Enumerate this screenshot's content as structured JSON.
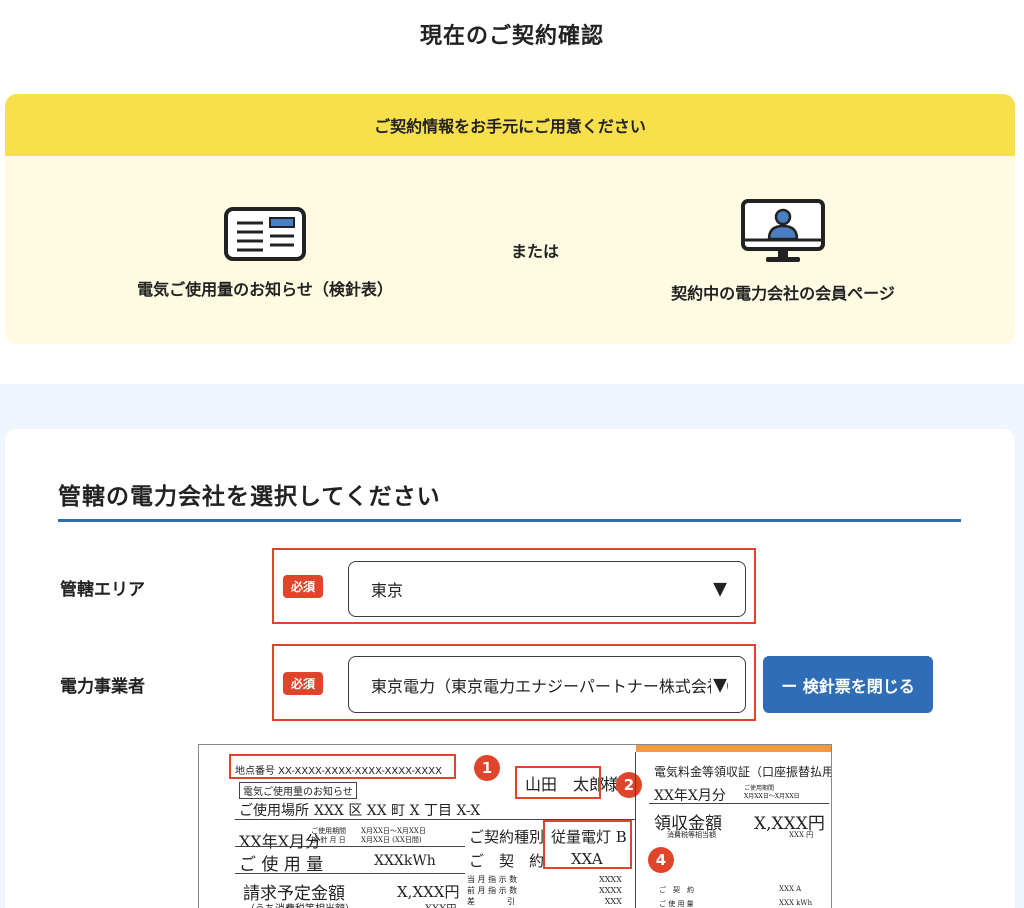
{
  "page_title": "現在のご契約確認",
  "prep": {
    "heading": "ご契約情報をお手元にご用意ください",
    "option_meter": "電気ご使用量のお知らせ（検針表）",
    "or_text": "または",
    "option_member": "契約中の電力会社の会員ページ"
  },
  "form": {
    "section_title": "管轄の電力会社を選択してください",
    "area": {
      "label": "管轄エリア",
      "required": "必須",
      "value": "東京"
    },
    "provider": {
      "label": "電力事業者",
      "required": "必須",
      "value": "東京電力（東京電力エナジーパートナー株式会社）"
    },
    "close_button": "ー 検針票を閉じる"
  },
  "slip": {
    "point_number": "地点番号 XX-XXXX-XXXX-XXXX-XXXX-XXXX",
    "notice_title": "電気ご使用量のお知らせ",
    "address_label": "ご使用場所",
    "address_value": "XXX 区 XX 町 X 丁目 X-X",
    "name": "山田　太郎",
    "name_suffix": "様",
    "month": "XX年X月分",
    "period_label": "ご使用期間\n検 針 月 日",
    "period_value": "X月XX日〜X月XX日\nX月XX日 (XX日間)",
    "usage_label": "ご 使 用 量",
    "usage_value": "XXXkWh",
    "contract_type_label": "ご契約種別",
    "contract_type_value": "従量電灯 B",
    "contract_label": "ご　契　約",
    "contract_value": "XXA",
    "billing_label": "請求予定金額",
    "billing_value": "X,XXX円",
    "tax_label": "（うち消費税等相当額）",
    "tax_value": "XXX円",
    "readings_labels": "当 月 指 示 数\n前 月 指 示 数\n差　　　　引",
    "readings_values": "XXXX\nXXXX\nXXX",
    "receipt_title": "電気料金等領収証（口座振替払用）",
    "receipt_month": "XX年X月分",
    "receipt_period": "ご使用期間\nX月XX日〜X月XX日",
    "receipt_amount_label": "領収金額",
    "receipt_amount_value": "X,XXX円",
    "receipt_tax_label": "消費税等相当額",
    "receipt_tax_value": "XXX 円",
    "receipt_contract": "ご　契　約",
    "receipt_contract_value": "XXX A",
    "receipt_usage": "ご 使 用 量",
    "receipt_usage_value": "XXX kWh",
    "markers": [
      "1",
      "2",
      "4"
    ]
  },
  "colors": {
    "accent_blue": "#2f6eb7",
    "required_red": "#e0452c",
    "banner_yellow": "#f8e04c",
    "panel_cream": "#fffbe3",
    "band_blue": "#eef5fc"
  },
  "icons": [
    "bill-icon",
    "monitor-user-icon",
    "dropdown-arrow-icon"
  ]
}
